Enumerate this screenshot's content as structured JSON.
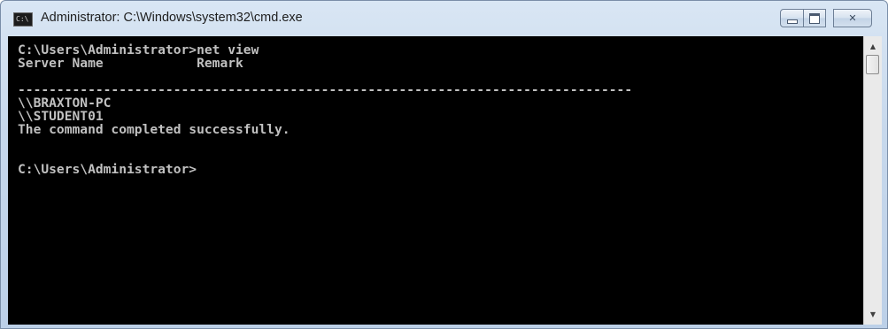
{
  "window": {
    "title": "Administrator: C:\\Windows\\system32\\cmd.exe",
    "icon": "cmd-console-icon",
    "icon_label": "C:\\",
    "controls": {
      "minimize": "minimize-icon",
      "maximize": "maximize-icon",
      "close_glyph": "✕"
    }
  },
  "console": {
    "lines": [
      "C:\\Users\\Administrator>net view",
      "Server Name            Remark",
      "",
      "-------------------------------------------------------------------------------",
      "\\\\BRAXTON-PC",
      "\\\\STUDENT01",
      "The command completed successfully.",
      "",
      "",
      "C:\\Users\\Administrator>"
    ]
  },
  "scrollbar": {
    "up_glyph": "▲",
    "down_glyph": "▼"
  },
  "colors": {
    "console_bg": "#000000",
    "console_fg": "#c0c0c0",
    "titlebar": "#c7d8ec"
  }
}
